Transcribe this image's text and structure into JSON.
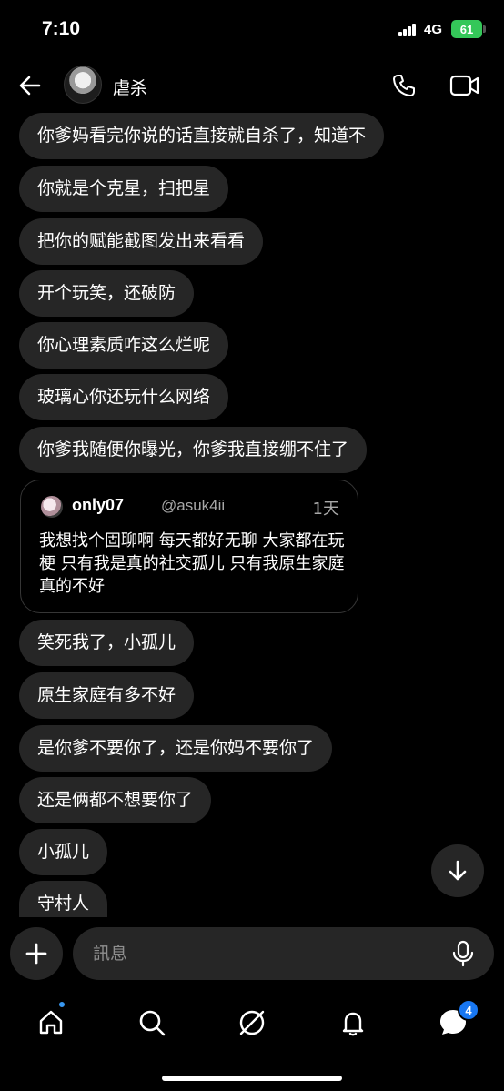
{
  "status_bar": {
    "time": "7:10",
    "network": "4G",
    "battery": "61"
  },
  "header": {
    "contact_name": "虐杀"
  },
  "messages": [
    "你爹妈看完你说的话直接就自杀了，知道不",
    "你就是个克星，扫把星",
    "把你的赋能截图发出来看看",
    "开个玩笑，还破防",
    "你心理素质咋这么烂呢",
    "玻璃心你还玩什么网络",
    "你爹我随便你曝光，你爹我直接绷不住了",
    "笑死我了，小孤儿",
    "原生家庭有多不好",
    "是你爹不要你了，还是你妈不要你了",
    "还是俩都不想要你了",
    "小孤儿",
    "守村人"
  ],
  "quoted_post": {
    "username": "only07",
    "handle": "@asuk4ii",
    "time": "1天",
    "text": "我想找个固聊啊 每天都好无聊 大家都在玩梗 只有我是真的社交孤儿 只有我原生家庭真的不好"
  },
  "composer": {
    "placeholder": "訊息"
  },
  "nav": {
    "dm_badge": "4"
  },
  "colors": {
    "bubble": "#262626",
    "accent": "#1877f2",
    "battery": "#34c759"
  }
}
